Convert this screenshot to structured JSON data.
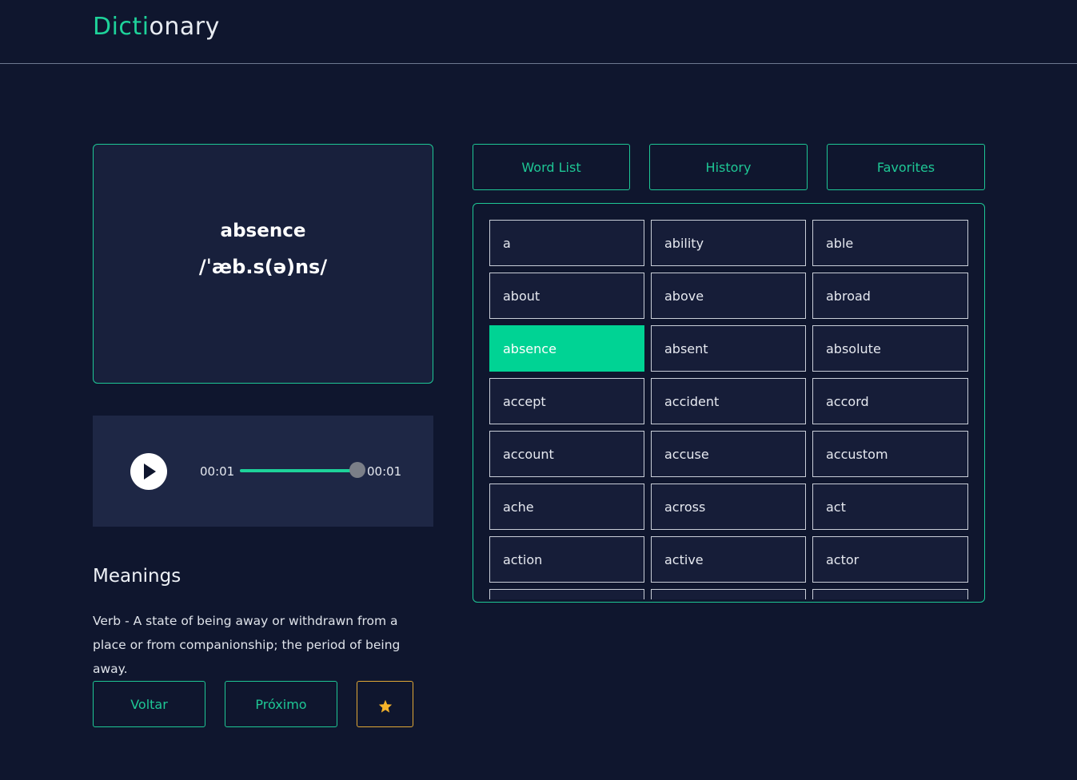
{
  "app": {
    "logo_accent": "Dicti",
    "logo_rest": "onary"
  },
  "word": {
    "title": "absence",
    "phonetic": "/ˈæb.s(ə)ns/"
  },
  "player": {
    "current_time": "00:01",
    "duration": "00:01",
    "progress": 1.0
  },
  "meanings": {
    "title": "Meanings",
    "text": "Verb - A state of being away or withdrawn from a place or from companionship; the period of being away."
  },
  "buttons": {
    "back": "Voltar",
    "next": "Próximo",
    "favorite_icon": "star-icon"
  },
  "tabs": [
    "Word List",
    "History",
    "Favorites"
  ],
  "word_list": {
    "selected": "absence",
    "items": [
      "a",
      "ability",
      "able",
      "about",
      "above",
      "abroad",
      "absence",
      "absent",
      "absolute",
      "accept",
      "accident",
      "accord",
      "account",
      "accuse",
      "accustom",
      "ache",
      "across",
      "act",
      "action",
      "active",
      "actor",
      "",
      "",
      ""
    ]
  },
  "colors": {
    "accent": "#1ed29a",
    "selected_bg": "#00d394",
    "favorite": "#f5b32a",
    "background": "#0f162e"
  }
}
